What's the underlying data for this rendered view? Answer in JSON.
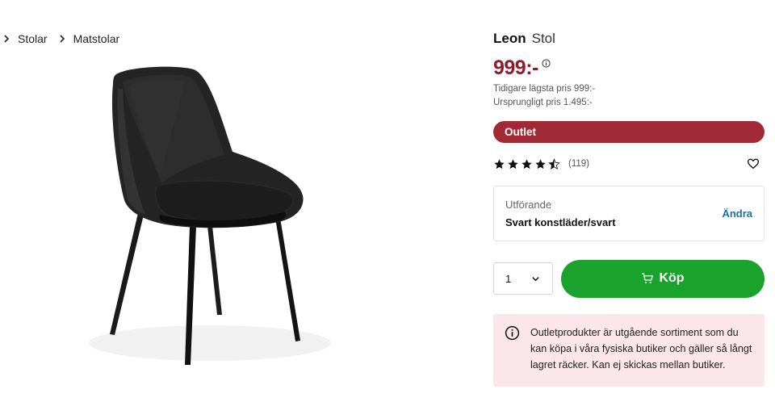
{
  "breadcrumb": {
    "items": [
      {
        "label": ""
      },
      {
        "label": "Stolar"
      },
      {
        "label": "Matstolar"
      }
    ]
  },
  "product": {
    "brand": "Leon",
    "type": "Stol",
    "price": "999:-",
    "lowest_price_note": "Tidigare lägsta pris 999:-",
    "original_price_note": "Ursprungligt pris 1.495:-",
    "badge": "Outlet",
    "rating": {
      "value": 4.5,
      "max": 5,
      "count_label": "(119)"
    },
    "image_alt": "Svart matstol Leon"
  },
  "variant": {
    "label": "Utförande",
    "value": "Svart konstläder/svart",
    "change_label": "Ändra"
  },
  "purchase": {
    "quantity": "1",
    "buy_label": "Köp"
  },
  "notice": {
    "text": "Outletprodukter är utgående sortiment som du kan köpa i våra fysiska butiker och gäller så långt lagret räcker. Kan ej skickas mellan butiker."
  },
  "colors": {
    "price": "#8e1c2a",
    "badge": "#a22a36",
    "buy": "#19a22c",
    "link": "#1d6fa8",
    "notice_bg": "#fbe7e9"
  },
  "icons": [
    "chevron-right-icon",
    "info-icon",
    "star-icon",
    "star-half-icon",
    "heart-icon",
    "chevron-down-icon",
    "cart-icon"
  ]
}
